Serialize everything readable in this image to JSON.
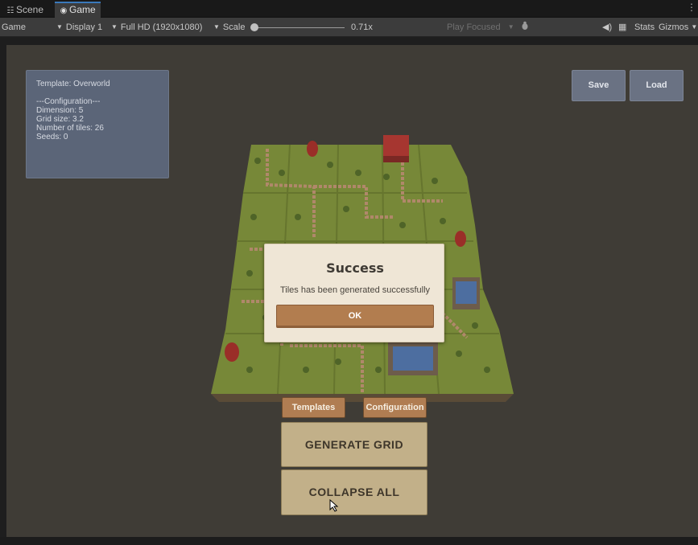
{
  "tabs": [
    {
      "label": "Scene",
      "icon": "grid-icon"
    },
    {
      "label": "Game",
      "icon": "gamepad-icon"
    }
  ],
  "toolbar": {
    "view_mode": "Game",
    "display": "Display 1",
    "resolution": "Full HD (1920x1080)",
    "scale_label": "Scale",
    "scale_value": "0.71x",
    "play_mode": "Play Focused",
    "stats": "Stats",
    "gizmos": "Gizmos"
  },
  "template_panel": {
    "template": "Template: Overworld",
    "config_header": "---Configuration---",
    "dimension": "Dimension: 5",
    "grid_size": "Grid size: 3.2",
    "tiles": "Number of tiles: 26",
    "seeds": "Seeds: 0"
  },
  "actions": {
    "save": "Save",
    "load": "Load",
    "templates": "Templates",
    "configuration": "Configuration",
    "generate": "GENERATE GRID",
    "collapse": "COLLAPSE ALL"
  },
  "dialog": {
    "title": "Success",
    "message": "Tiles has been generated successfully",
    "ok": "OK"
  },
  "colors": {
    "grass": "#7a8a3c",
    "path": "#b0886a",
    "dialog_bg": "#efe6d6",
    "ok_button": "#b27d4f",
    "panel": "#5b6578"
  }
}
